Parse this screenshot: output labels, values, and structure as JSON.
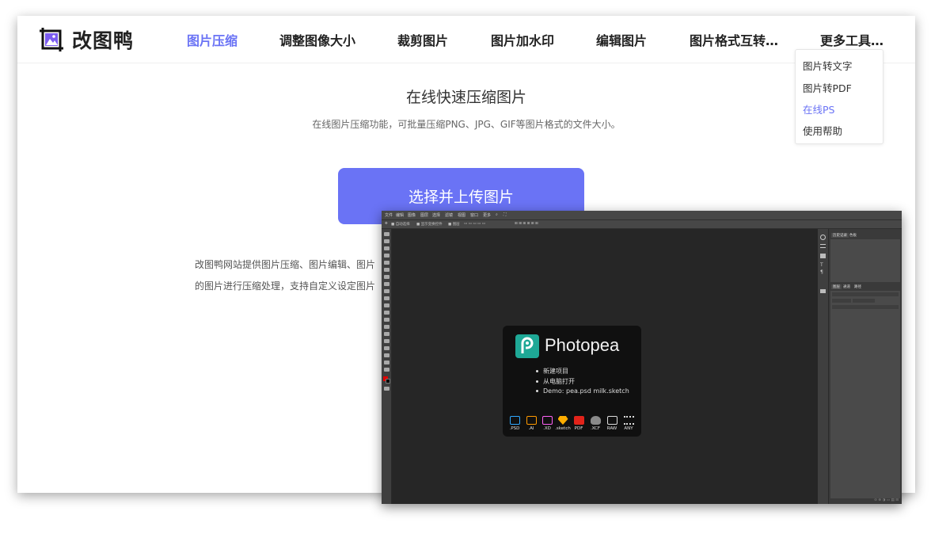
{
  "site": {
    "logo_text": "改图鸭",
    "nav": [
      {
        "label": "图片压缩",
        "active": true
      },
      {
        "label": "调整图像大小"
      },
      {
        "label": "裁剪图片"
      },
      {
        "label": "图片加水印"
      },
      {
        "label": "编辑图片"
      },
      {
        "label": "图片格式互转…"
      },
      {
        "label": "更多工具…"
      }
    ],
    "dropdown": [
      {
        "label": "图片转文字"
      },
      {
        "label": "图片转PDF"
      },
      {
        "label": "在线PS",
        "active": true
      },
      {
        "label": "使用帮助"
      }
    ],
    "hero_title": "在线快速压缩图片",
    "hero_subtitle": "在线图片压缩功能，可批量压缩PNG、JPG、GIF等图片格式的文件大小。",
    "upload_button": "选择并上传图片",
    "description_line1": "改图鸭网站提供图片压缩、图片编辑、图片",
    "description_line2": "的图片进行压缩处理，支持自定义设定图片"
  },
  "photopea": {
    "menu": [
      "文件",
      "编辑",
      "图像",
      "图层",
      "选择",
      "滤镜",
      "视图",
      "窗口",
      "更多"
    ],
    "options": [
      "自动选择",
      "显示变换控件",
      "图层"
    ],
    "panel_tabs_top": [
      "历史记录",
      "色板"
    ],
    "panel_tabs_bottom": [
      "图层",
      "通道",
      "路径"
    ],
    "app_name": "Photopea",
    "links": [
      "新建项目",
      "从电脑打开",
      "Demo:   pea.psd   milk.sketch"
    ],
    "formats": [
      {
        "label": ".PSD",
        "color": "#31a8ff"
      },
      {
        "label": ".AI",
        "color": "#ff9a00"
      },
      {
        "label": ".XD",
        "color": "#ff61f6"
      },
      {
        "label": ".sketch",
        "color": "#fdad00"
      },
      {
        "label": "PDF",
        "color": "#e2231a"
      },
      {
        "label": ".XCF",
        "color": "#8a8a8a"
      },
      {
        "label": "RAW",
        "color": "#dddddd"
      },
      {
        "label": "ANY",
        "color": "#dddddd"
      }
    ],
    "brand_color": "#1ea896"
  },
  "colors": {
    "accent": "#6a73f5"
  }
}
